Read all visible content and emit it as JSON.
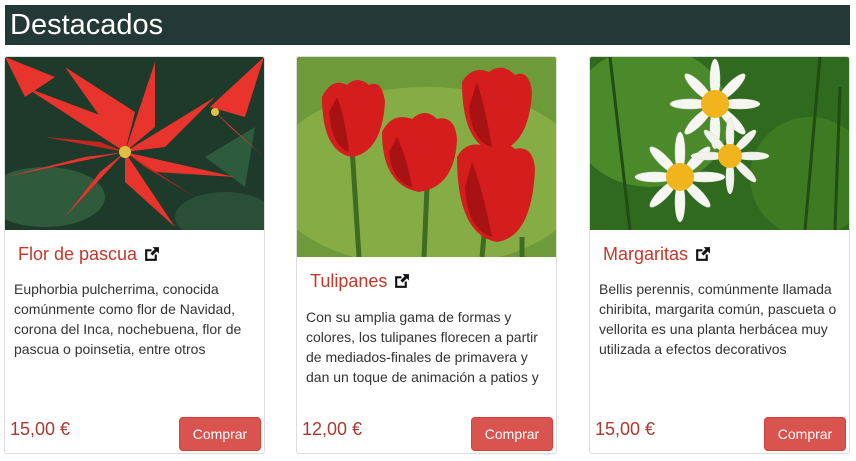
{
  "header": {
    "title": "Destacados"
  },
  "products": [
    {
      "name": "Flor de pascua",
      "description": "Euphorbia pulcherrima, conocida comúnmente como flor de Navidad, corona del Inca, nochebuena, flor de pascua o poinsetia, entre otros",
      "price": "15,00 €",
      "buy_label": "Comprar",
      "image_icon": "poinsettia-photo"
    },
    {
      "name": "Tulipanes",
      "description": "Con su amplia gama de formas y colores, los tulipanes florecen a partir de mediados-finales de primavera y dan un toque de animación a patios y",
      "price": "12,00 €",
      "buy_label": "Comprar",
      "image_icon": "tulips-photo"
    },
    {
      "name": "Margaritas",
      "description": "Bellis perennis, comúnmente llamada chiribita, margarita común, pascueta o vellorita es una planta herbácea muy utilizada a efectos decorativos",
      "price": "15,00 €",
      "buy_label": "Comprar",
      "image_icon": "daisies-photo"
    }
  ],
  "colors": {
    "header_bg": "#233837",
    "accent": "#c0392b",
    "button": "#d9534f"
  }
}
